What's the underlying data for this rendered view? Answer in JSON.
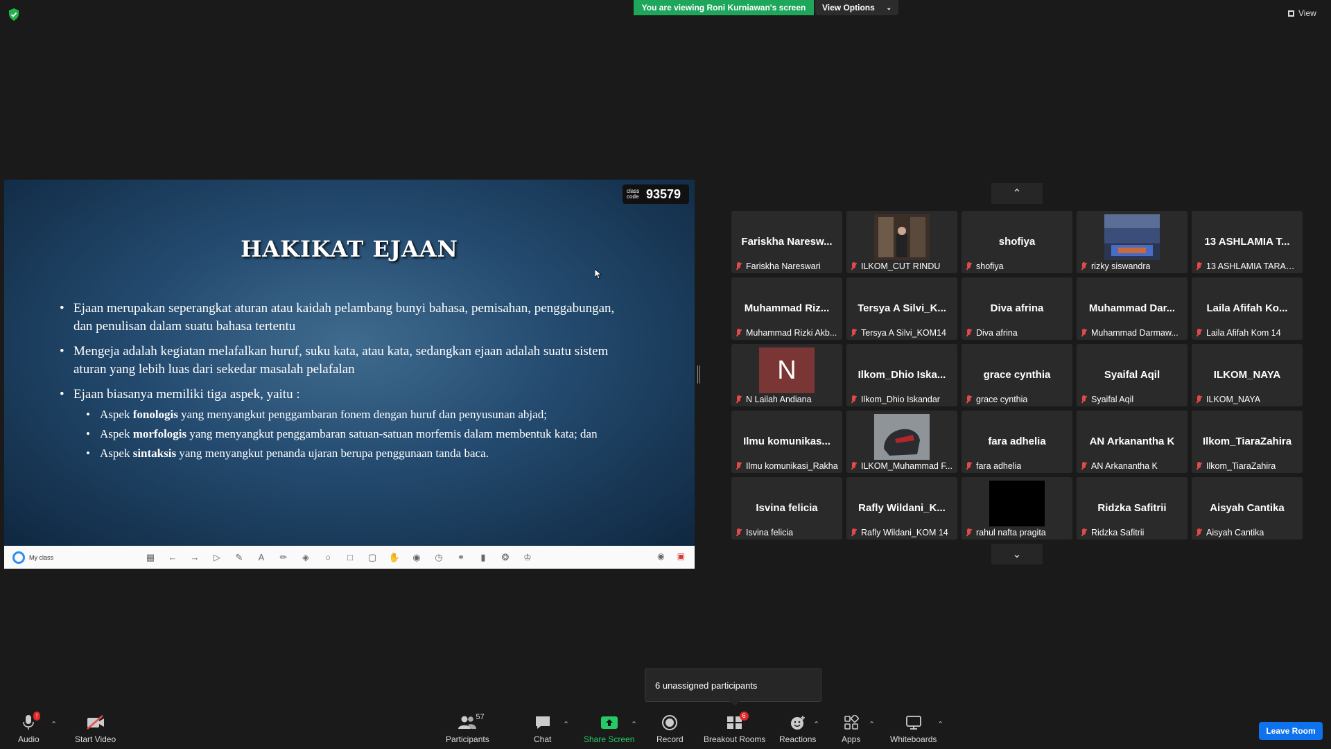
{
  "top": {
    "viewing_banner": "You are viewing Roni Kurniawan's screen",
    "view_options": "View Options",
    "view": "View"
  },
  "slide": {
    "class_code_label": "class code",
    "class_code": "93579",
    "title": "HAKIKAT EJAAN",
    "bullets": [
      "Ejaan merupakan seperangkat aturan atau kaidah pelambang bunyi bahasa, pemisahan, penggabungan, dan penulisan dalam suatu bahasa tertentu",
      "Mengeja adalah kegiatan melafalkan huruf, suku kata, atau kata, sedangkan ejaan adalah suatu sistem aturan yang lebih luas dari sekedar masalah pelafalan",
      "Ejaan biasanya memiliki tiga aspek, yaitu :"
    ],
    "sub_bullets": [
      {
        "pre": "Aspek ",
        "bold": "fonologis",
        "post": " yang menyangkut penggambaran fonem dengan huruf dan penyusunan abjad;"
      },
      {
        "pre": "Aspek ",
        "bold": "morfologis",
        "post": " yang menyangkut penggambaran satuan-satuan morfemis dalam membentuk kata; dan"
      },
      {
        "pre": "Aspek ",
        "bold": "sintaksis",
        "post": " yang menyangkut penanda ujaran berupa penggunaan tanda baca."
      }
    ],
    "toolbar_app": "My class"
  },
  "participants": [
    {
      "big": "Fariskha  Naresw...",
      "name": "Fariskha Nareswari",
      "thumb": "none"
    },
    {
      "big": "",
      "name": "ILKOM_CUT RINDU",
      "thumb": "video-room"
    },
    {
      "big": "shofiya",
      "name": "shofiya",
      "thumb": "none"
    },
    {
      "big": "",
      "name": "rizky siswandra",
      "thumb": "video-stadium"
    },
    {
      "big": "13  ASHLAMIA  T...",
      "name": "13 ASHLAMIA TARADI...",
      "thumb": "none"
    },
    {
      "big": "Muhammad  Riz...",
      "name": "Muhammad Rizki Akb...",
      "thumb": "none"
    },
    {
      "big": "Tersya  A  Silvi_K...",
      "name": "Tersya A Silvi_KOM14",
      "thumb": "none"
    },
    {
      "big": "Diva afrina",
      "name": "Diva afrina",
      "thumb": "none"
    },
    {
      "big": "Muhammad  Dar...",
      "name": "Muhammad Darmaw...",
      "thumb": "none"
    },
    {
      "big": "Laila  Afifah  Ko...",
      "name": "Laila Afifah Kom 14",
      "thumb": "none"
    },
    {
      "big": "N",
      "name": "N Lailah Andiana",
      "thumb": "initial"
    },
    {
      "big": "Ilkom_Dhio  Iska...",
      "name": "Ilkom_Dhio Iskandar",
      "thumb": "none"
    },
    {
      "big": "grace cynthia",
      "name": "grace cynthia",
      "thumb": "none"
    },
    {
      "big": "Syaifal Aqil",
      "name": "Syaifal Aqil",
      "thumb": "none"
    },
    {
      "big": "ILKOM_NAYA",
      "name": "ILKOM_NAYA",
      "thumb": "none"
    },
    {
      "big": "Ilmu  komunikas...",
      "name": "Ilmu komunikasi_Rakha",
      "thumb": "none"
    },
    {
      "big": "",
      "name": "ILKOM_Muhammad F...",
      "thumb": "video-helmet"
    },
    {
      "big": "fara adhelia",
      "name": "fara adhelia",
      "thumb": "none"
    },
    {
      "big": "AN Arkanantha K",
      "name": "AN Arkanantha K",
      "thumb": "none"
    },
    {
      "big": "Ilkom_TiaraZahira",
      "name": "Ilkom_TiaraZahira",
      "thumb": "none"
    },
    {
      "big": "Isvina felicia",
      "name": "Isvina felicia",
      "thumb": "none"
    },
    {
      "big": "Rafly  Wildani_K...",
      "name": "Rafly Wildani_KOM 14",
      "thumb": "none"
    },
    {
      "big": "",
      "name": "rahul nafta pragita",
      "thumb": "video-black"
    },
    {
      "big": "Ridzka Safitrii",
      "name": "Ridzka Safitrii",
      "thumb": "none"
    },
    {
      "big": "Aisyah Cantika",
      "name": "Aisyah Cantika",
      "thumb": "none"
    }
  ],
  "tooltip": "6 unassigned participants",
  "controls": {
    "audio": "Audio",
    "audio_badge": "!",
    "start_video": "Start Video",
    "participants": "Participants",
    "participants_count": "57",
    "chat": "Chat",
    "share_screen": "Share Screen",
    "record": "Record",
    "breakout": "Breakout Rooms",
    "breakout_badge": "6",
    "reactions": "Reactions",
    "apps": "Apps",
    "whiteboards": "Whiteboards",
    "leave": "Leave Room"
  },
  "colors": {
    "banner_green": "#1ea65b",
    "leave_blue": "#0e72ed",
    "share_green": "#26c964",
    "mute_red": "#e24a4a"
  }
}
